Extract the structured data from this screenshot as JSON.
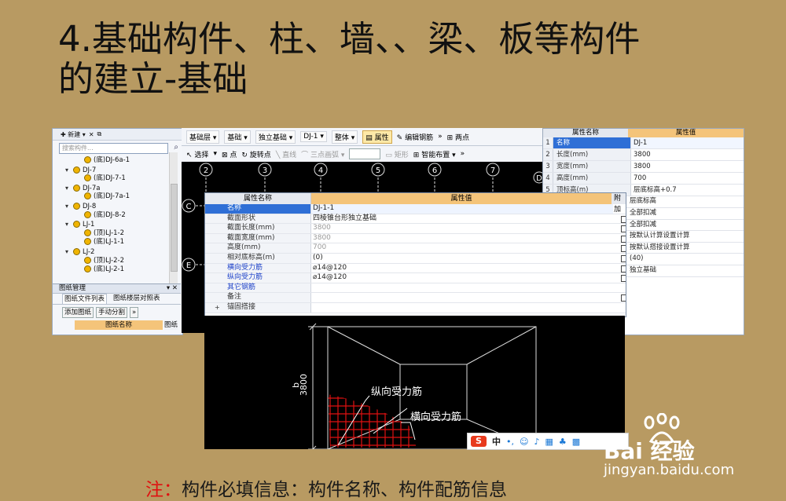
{
  "slide": {
    "title_line1": "4.基础构件、柱、墙、、梁、板等构件",
    "title_line2": "的建立-基础",
    "note_prefix": "注：",
    "note_text": "构件必填信息：构件名称、构件配筋信息"
  },
  "left_panel": {
    "toolbar": {
      "new_label": "新建",
      "close": "✕"
    },
    "search_placeholder": "搜索构件...",
    "tree": [
      {
        "indent": 1,
        "label": "(底)DJ-6a-1",
        "dot": true,
        "toggle": ""
      },
      {
        "indent": 0,
        "label": "DJ-7",
        "dot": true,
        "toggle": "▾"
      },
      {
        "indent": 1,
        "label": "(底)DJ-7-1",
        "dot": true,
        "toggle": ""
      },
      {
        "indent": 0,
        "label": "DJ-7a",
        "dot": true,
        "toggle": "▾"
      },
      {
        "indent": 1,
        "label": "(底)DJ-7a-1",
        "dot": true,
        "toggle": ""
      },
      {
        "indent": 0,
        "label": "DJ-8",
        "dot": true,
        "toggle": "▾"
      },
      {
        "indent": 1,
        "label": "(底)DJ-8-2",
        "dot": true,
        "toggle": ""
      },
      {
        "indent": 0,
        "label": "LJ-1",
        "dot": true,
        "toggle": "▾"
      },
      {
        "indent": 1,
        "label": "(顶)LJ-1-2",
        "dot": true,
        "toggle": ""
      },
      {
        "indent": 1,
        "label": "(底)LJ-1-1",
        "dot": true,
        "toggle": ""
      },
      {
        "indent": 0,
        "label": "LJ-2",
        "dot": true,
        "toggle": "▾"
      },
      {
        "indent": 1,
        "label": "(顶)LJ-2-2",
        "dot": true,
        "toggle": ""
      },
      {
        "indent": 1,
        "label": "(底)LJ-2-1",
        "dot": true,
        "toggle": ""
      }
    ],
    "drawing_mgmt": {
      "header": "图纸管理",
      "tabs": [
        "图纸文件列表",
        "图纸楼层对照表"
      ],
      "buttons": [
        "添加图纸",
        "手动分割"
      ],
      "column": "图纸名称",
      "column2": "图纸"
    }
  },
  "toolbar": {
    "row1": [
      "基础层",
      "基础",
      "独立基础",
      "DJ-1",
      "整体"
    ],
    "property_btn": "属性",
    "edit_rebar_btn": "编辑钢筋",
    "two_point": "两点",
    "row2": {
      "select": "选择",
      "point": "点",
      "rotate_point": "旋转点",
      "line": "直线",
      "three_point_arc": "三点画弧",
      "rect": "矩形",
      "smart_layout": "智能布置"
    }
  },
  "canvas": {
    "axis_top": [
      "2",
      "3",
      "4",
      "5",
      "6",
      "7"
    ],
    "axis_left": [
      "C",
      "E",
      "D",
      "C"
    ]
  },
  "right_panel": {
    "headers": [
      "属性名称",
      "属性值"
    ],
    "rows": [
      {
        "n": "1",
        "k": "名称",
        "v": "DJ-1"
      },
      {
        "n": "2",
        "k": "长度(mm)",
        "v": "3800"
      },
      {
        "n": "3",
        "k": "宽度(mm)",
        "v": "3800"
      },
      {
        "n": "4",
        "k": "高度(mm)",
        "v": "700"
      },
      {
        "n": "5",
        "k": "顶标高(m)",
        "v": "层底标高+0.7"
      }
    ],
    "extra": [
      "层底标高",
      "全部扣减",
      "全部扣减",
      "按默认计算设置计算",
      "按默认搭接设置计算",
      "(40)",
      "独立基础"
    ]
  },
  "dialog": {
    "headers": [
      "属性名称",
      "属性值",
      "附加"
    ],
    "rows": [
      {
        "k": "名称",
        "v": "DJ-1-1",
        "sel": true,
        "blue": false,
        "gray": false,
        "cb": false
      },
      {
        "k": "截面形状",
        "v": "四棱锥台形独立基础",
        "sel": false,
        "blue": false,
        "gray": false,
        "cb": true
      },
      {
        "k": "截面长度(mm)",
        "v": "3800",
        "sel": false,
        "blue": false,
        "gray": true,
        "cb": true
      },
      {
        "k": "截面宽度(mm)",
        "v": "3800",
        "sel": false,
        "blue": false,
        "gray": true,
        "cb": true
      },
      {
        "k": "高度(mm)",
        "v": "700",
        "sel": false,
        "blue": false,
        "gray": true,
        "cb": true
      },
      {
        "k": "相对底标高(m)",
        "v": "(0)",
        "sel": false,
        "blue": false,
        "gray": false,
        "cb": true
      },
      {
        "k": "横向受力筋",
        "v": "⌀14@120",
        "sel": false,
        "blue": true,
        "gray": false,
        "cb": true
      },
      {
        "k": "纵向受力筋",
        "v": "⌀14@120",
        "sel": false,
        "blue": true,
        "gray": false,
        "cb": true
      },
      {
        "k": "其它钢筋",
        "v": "",
        "sel": false,
        "blue": true,
        "gray": false,
        "cb": false
      },
      {
        "k": "备注",
        "v": "",
        "sel": false,
        "blue": false,
        "gray": false,
        "cb": true
      },
      {
        "k": "锚固搭接",
        "v": "",
        "sel": false,
        "blue": false,
        "gray": true,
        "cb": false,
        "plus": true
      }
    ]
  },
  "diagram": {
    "label_long": "纵向受力筋",
    "label_trans": "横向受力筋",
    "dim_b": "b",
    "dim_value": "3800"
  },
  "ime": {
    "s": "S",
    "zh": "中"
  },
  "watermark": {
    "logo": "Bai 经验",
    "url": "jingyan.baidu.com"
  },
  "colors": {
    "background": "#b89a62",
    "header_orange": "#f4c47a",
    "select_blue": "#2f6fd6",
    "hatch_red": "#e01010"
  }
}
